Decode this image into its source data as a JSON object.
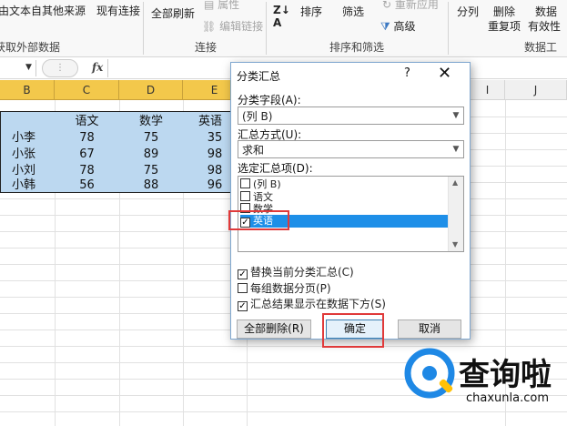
{
  "ribbon": {
    "items": [
      "由文本",
      "自其他来源",
      "现有连接",
      "全部刷新",
      "属性",
      "编辑链接",
      "排序",
      "筛选",
      "重新应用",
      "高级",
      "分列",
      "删除",
      "重复项",
      "数据",
      "有效性"
    ],
    "groups": [
      "获取外部数据",
      "连接",
      "排序和筛选",
      "数据工"
    ]
  },
  "formula_bar": {
    "fx": "fx"
  },
  "columns": [
    "B",
    "C",
    "D",
    "E",
    "I",
    "J"
  ],
  "table": {
    "headers": [
      "语文",
      "数学",
      "英语"
    ],
    "rows": [
      {
        "name": "小李",
        "values": [
          "78",
          "75",
          "35"
        ]
      },
      {
        "name": "小张",
        "values": [
          "67",
          "89",
          "98"
        ]
      },
      {
        "name": "小刘",
        "values": [
          "78",
          "75",
          "98"
        ]
      },
      {
        "name": "小韩",
        "values": [
          "56",
          "88",
          "96"
        ]
      }
    ]
  },
  "dialog": {
    "title": "分类汇总",
    "help": "?",
    "close": "✕",
    "field_label": "分类字段(A):",
    "field_value": "(列 B)",
    "method_label": "汇总方式(U):",
    "method_value": "求和",
    "items_label": "选定汇总项(D):",
    "items": [
      {
        "label": "(列 B)",
        "checked": false
      },
      {
        "label": "语文",
        "checked": false
      },
      {
        "label": "数学",
        "checked": false
      },
      {
        "label": "英语",
        "checked": true
      }
    ],
    "options": [
      {
        "label": "替换当前分类汇总(C)",
        "checked": true
      },
      {
        "label": "每组数据分页(P)",
        "checked": false
      },
      {
        "label": "汇总结果显示在数据下方(S)",
        "checked": true
      }
    ],
    "btn_remove": "全部删除(R)",
    "btn_ok": "确定",
    "btn_cancel": "取消"
  },
  "watermark": {
    "cn": "查询啦",
    "url": "chaxunla.com"
  },
  "colors": {
    "selection": "#bcd8f0",
    "header_highlight": "#f3c84b",
    "list_selected": "#1e8fe8",
    "highlight_box": "#e03a3a"
  }
}
